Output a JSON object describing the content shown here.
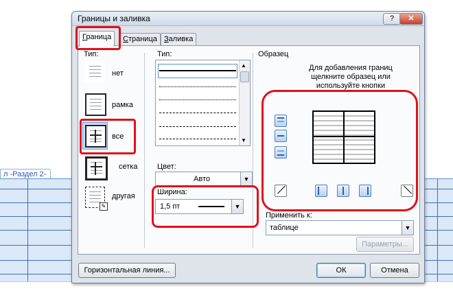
{
  "background_doc": {
    "section_label": "л -Раздел 2-"
  },
  "dialog": {
    "title": "Границы и заливка",
    "help_label": "?",
    "close_label": "✕",
    "tabs": [
      {
        "label": "Граница",
        "underline": "Г",
        "rest": "раница"
      },
      {
        "label": "Страница",
        "underline": "С",
        "rest": "траница"
      },
      {
        "label": "Заливка",
        "underline": "З",
        "rest": "аливка"
      }
    ],
    "type_section": {
      "label": "Тип:",
      "options": [
        {
          "label": "нет"
        },
        {
          "label": "рамка"
        },
        {
          "label": "все"
        },
        {
          "label": "сетка"
        },
        {
          "label": "другая"
        }
      ]
    },
    "style_section": {
      "label": "Тип:",
      "color_label": "Цвет:",
      "color_value": "Авто",
      "width_label": "Ширина:",
      "width_value": "1,5 пт"
    },
    "preview_section": {
      "label": "Образец",
      "hint": "Для добавления границ щелкните образец или используйте кнопки",
      "apply_label": "Применить к:",
      "apply_value": "таблице",
      "options_button": "Параметры..."
    },
    "horizontal_line_button": "Горизонтальная линия...",
    "ok_button": "ОК",
    "cancel_button": "Отмена"
  },
  "colors": {
    "highlight": "#e0101a",
    "selection": "#2f66c7",
    "dialog_bg": "#dfe3ea"
  }
}
